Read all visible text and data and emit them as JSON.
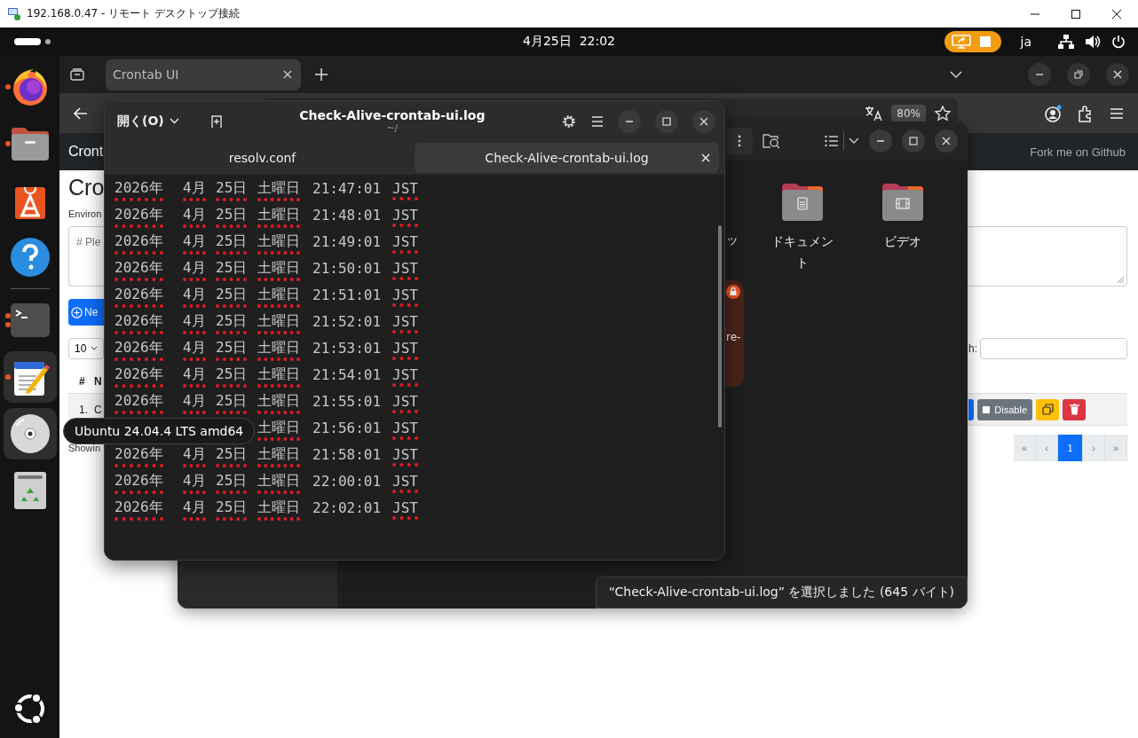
{
  "rdp_window": {
    "title": "192.168.0.47 - リモート デスクトップ接続"
  },
  "top_bar": {
    "clock": "4月25日  22:02",
    "input_method": "ja",
    "screen_sharing": true
  },
  "dock": {
    "favorites": [
      {
        "kind": "firefox",
        "running": true,
        "multiple": false,
        "highlighted": false
      },
      {
        "kind": "files",
        "running": true,
        "multiple": false,
        "highlighted": false
      },
      {
        "kind": "app-center",
        "running": false,
        "highlighted": false
      },
      {
        "kind": "help",
        "running": false,
        "highlighted": false
      }
    ],
    "others": [
      {
        "kind": "terminal",
        "running": true,
        "multiple": true,
        "highlighted": false
      },
      {
        "kind": "text-editor",
        "running": true,
        "multiple": false,
        "highlighted": true
      },
      {
        "kind": "disc",
        "running": false,
        "highlighted": true,
        "tooltip": "Ubuntu 24.04.4 LTS amd64"
      },
      {
        "kind": "trash",
        "running": false,
        "highlighted": false
      }
    ]
  },
  "browser": {
    "tabs": [
      {
        "label": "Crontab UI",
        "selected": true
      }
    ],
    "zoom": "80%",
    "page": {
      "brand": "Cront",
      "link": "Fork me on Github",
      "heading": "Cro",
      "env_label": "Environ",
      "textarea_placeholder": "# Ple",
      "new_button": "Ne",
      "page_size": "10",
      "search_label": "h:",
      "table_header": [
        "#",
        "N"
      ],
      "rows": [
        {
          "cells": [
            "1.",
            "C"
          ]
        }
      ],
      "row_actions": [
        {
          "kind": "primary"
        },
        {
          "kind": "disable",
          "label": "Disable"
        },
        {
          "kind": "duplicate"
        },
        {
          "kind": "delete"
        }
      ],
      "info": "Showin",
      "pagination": [
        {
          "label": "«",
          "selected": false
        },
        {
          "label": "‹",
          "selected": false
        },
        {
          "label": "1",
          "selected": true
        },
        {
          "label": "›",
          "selected": false
        },
        {
          "label": "»",
          "selected": false
        }
      ]
    }
  },
  "file_manager": {
    "partial_label": "ッ",
    "selected_item": {
      "label": "re-",
      "locked": true
    },
    "folders": [
      {
        "label": "ドキュメント",
        "kind": "documents"
      },
      {
        "label": "ビデオ",
        "kind": "videos"
      }
    ],
    "status": "“Check-Alive-crontab-ui.log” を選択しました (645 バイト)"
  },
  "text_editor": {
    "open_button": "開く(O)",
    "title": "Check-Alive-crontab-ui.log",
    "subtitle": "~/",
    "tabs": [
      {
        "label": "resolv.conf",
        "selected": false
      },
      {
        "label": "Check-Alive-crontab-ui.log",
        "selected": true
      }
    ],
    "lines": [
      {
        "tokens": [
          {
            "text": "2026年",
            "spell_error": true
          },
          {
            "text": "4月",
            "spell_error": true
          },
          {
            "text": "25日",
            "spell_error": true
          },
          {
            "text": "土曜日",
            "spell_error": true
          },
          {
            "text": "21:47:01",
            "spell_error": false
          },
          {
            "text": "JST",
            "spell_error": true
          }
        ]
      },
      {
        "tokens": [
          {
            "text": "2026年",
            "spell_error": true
          },
          {
            "text": "4月",
            "spell_error": true
          },
          {
            "text": "25日",
            "spell_error": true
          },
          {
            "text": "土曜日",
            "spell_error": true
          },
          {
            "text": "21:48:01",
            "spell_error": false
          },
          {
            "text": "JST",
            "spell_error": true
          }
        ]
      },
      {
        "tokens": [
          {
            "text": "2026年",
            "spell_error": true
          },
          {
            "text": "4月",
            "spell_error": true
          },
          {
            "text": "25日",
            "spell_error": true
          },
          {
            "text": "土曜日",
            "spell_error": true
          },
          {
            "text": "21:49:01",
            "spell_error": false
          },
          {
            "text": "JST",
            "spell_error": true
          }
        ]
      },
      {
        "tokens": [
          {
            "text": "2026年",
            "spell_error": true
          },
          {
            "text": "4月",
            "spell_error": true
          },
          {
            "text": "25日",
            "spell_error": true
          },
          {
            "text": "土曜日",
            "spell_error": true
          },
          {
            "text": "21:50:01",
            "spell_error": false
          },
          {
            "text": "JST",
            "spell_error": true
          }
        ]
      },
      {
        "tokens": [
          {
            "text": "2026年",
            "spell_error": true
          },
          {
            "text": "4月",
            "spell_error": true
          },
          {
            "text": "25日",
            "spell_error": true
          },
          {
            "text": "土曜日",
            "spell_error": true
          },
          {
            "text": "21:51:01",
            "spell_error": false
          },
          {
            "text": "JST",
            "spell_error": true
          }
        ]
      },
      {
        "tokens": [
          {
            "text": "2026年",
            "spell_error": true
          },
          {
            "text": "4月",
            "spell_error": true
          },
          {
            "text": "25日",
            "spell_error": true
          },
          {
            "text": "土曜日",
            "spell_error": true
          },
          {
            "text": "21:52:01",
            "spell_error": false
          },
          {
            "text": "JST",
            "spell_error": true
          }
        ]
      },
      {
        "tokens": [
          {
            "text": "2026年",
            "spell_error": true
          },
          {
            "text": "4月",
            "spell_error": true
          },
          {
            "text": "25日",
            "spell_error": true
          },
          {
            "text": "土曜日",
            "spell_error": true
          },
          {
            "text": "21:53:01",
            "spell_error": false
          },
          {
            "text": "JST",
            "spell_error": true
          }
        ]
      },
      {
        "tokens": [
          {
            "text": "2026年",
            "spell_error": true
          },
          {
            "text": "4月",
            "spell_error": true
          },
          {
            "text": "25日",
            "spell_error": true
          },
          {
            "text": "土曜日",
            "spell_error": true
          },
          {
            "text": "21:54:01",
            "spell_error": false
          },
          {
            "text": "JST",
            "spell_error": true
          }
        ]
      },
      {
        "tokens": [
          {
            "text": "2026年",
            "spell_error": true
          },
          {
            "text": "4月",
            "spell_error": true
          },
          {
            "text": "25日",
            "spell_error": true
          },
          {
            "text": "土曜日",
            "spell_error": true
          },
          {
            "text": "21:55:01",
            "spell_error": false
          },
          {
            "text": "JST",
            "spell_error": true
          }
        ]
      },
      {
        "tokens": [
          {
            "text": "土曜日",
            "spell_error": true
          },
          {
            "text": "21:56:01",
            "spell_error": false
          },
          {
            "text": "JST",
            "spell_error": true
          }
        ]
      },
      {
        "tokens": [
          {
            "text": "2026年",
            "spell_error": true
          },
          {
            "text": "4月",
            "spell_error": true
          },
          {
            "text": "25日",
            "spell_error": true
          },
          {
            "text": "土曜日",
            "spell_error": true
          },
          {
            "text": "21:58:01",
            "spell_error": false
          },
          {
            "text": "JST",
            "spell_error": true
          }
        ]
      },
      {
        "tokens": [
          {
            "text": "2026年",
            "spell_error": true
          },
          {
            "text": "4月",
            "spell_error": true
          },
          {
            "text": "25日",
            "spell_error": true
          },
          {
            "text": "土曜日",
            "spell_error": true
          },
          {
            "text": "22:00:01",
            "spell_error": false
          },
          {
            "text": "JST",
            "spell_error": true
          }
        ]
      },
      {
        "tokens": [
          {
            "text": "2026年",
            "spell_error": true
          },
          {
            "text": "4月",
            "spell_error": true
          },
          {
            "text": "25日",
            "spell_error": true
          },
          {
            "text": "土曜日",
            "spell_error": true
          },
          {
            "text": "22:02:01",
            "spell_error": false
          },
          {
            "text": "JST",
            "spell_error": true
          }
        ]
      }
    ]
  }
}
